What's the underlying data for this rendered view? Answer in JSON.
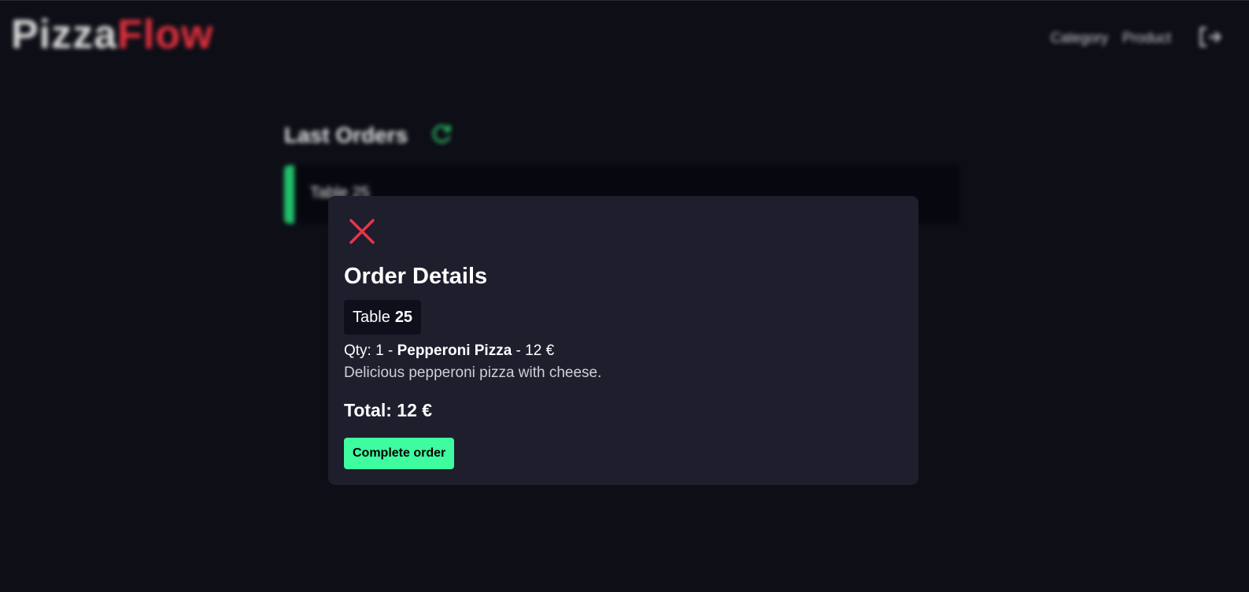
{
  "header": {
    "logo_part1": "Pizza",
    "logo_part2": "Flow",
    "nav": [
      "Category",
      "Product"
    ],
    "logout_icon": "logout-icon"
  },
  "orders": {
    "title": "Last Orders",
    "refresh_icon": "refresh-icon",
    "items": [
      {
        "label": "Table 25"
      }
    ]
  },
  "modal": {
    "close_icon": "close-icon",
    "title": "Order Details",
    "table_label": "Table",
    "table_number": "25",
    "item_qty_prefix": "Qty: 1 - ",
    "item_name": "Pepperoni Pizza",
    "item_price_suffix": " - 12 €",
    "item_description": "Delicious pepperoni pizza with cheese.",
    "total": "Total: 12 €",
    "complete_button": "Complete order"
  },
  "colors": {
    "background": "#0d0e16",
    "modal_bg": "#1e1e2d",
    "accent_green": "#3efc9f",
    "status_green": "#20c16a",
    "brand_red": "#e0303e",
    "close_red": "#e8354a"
  }
}
